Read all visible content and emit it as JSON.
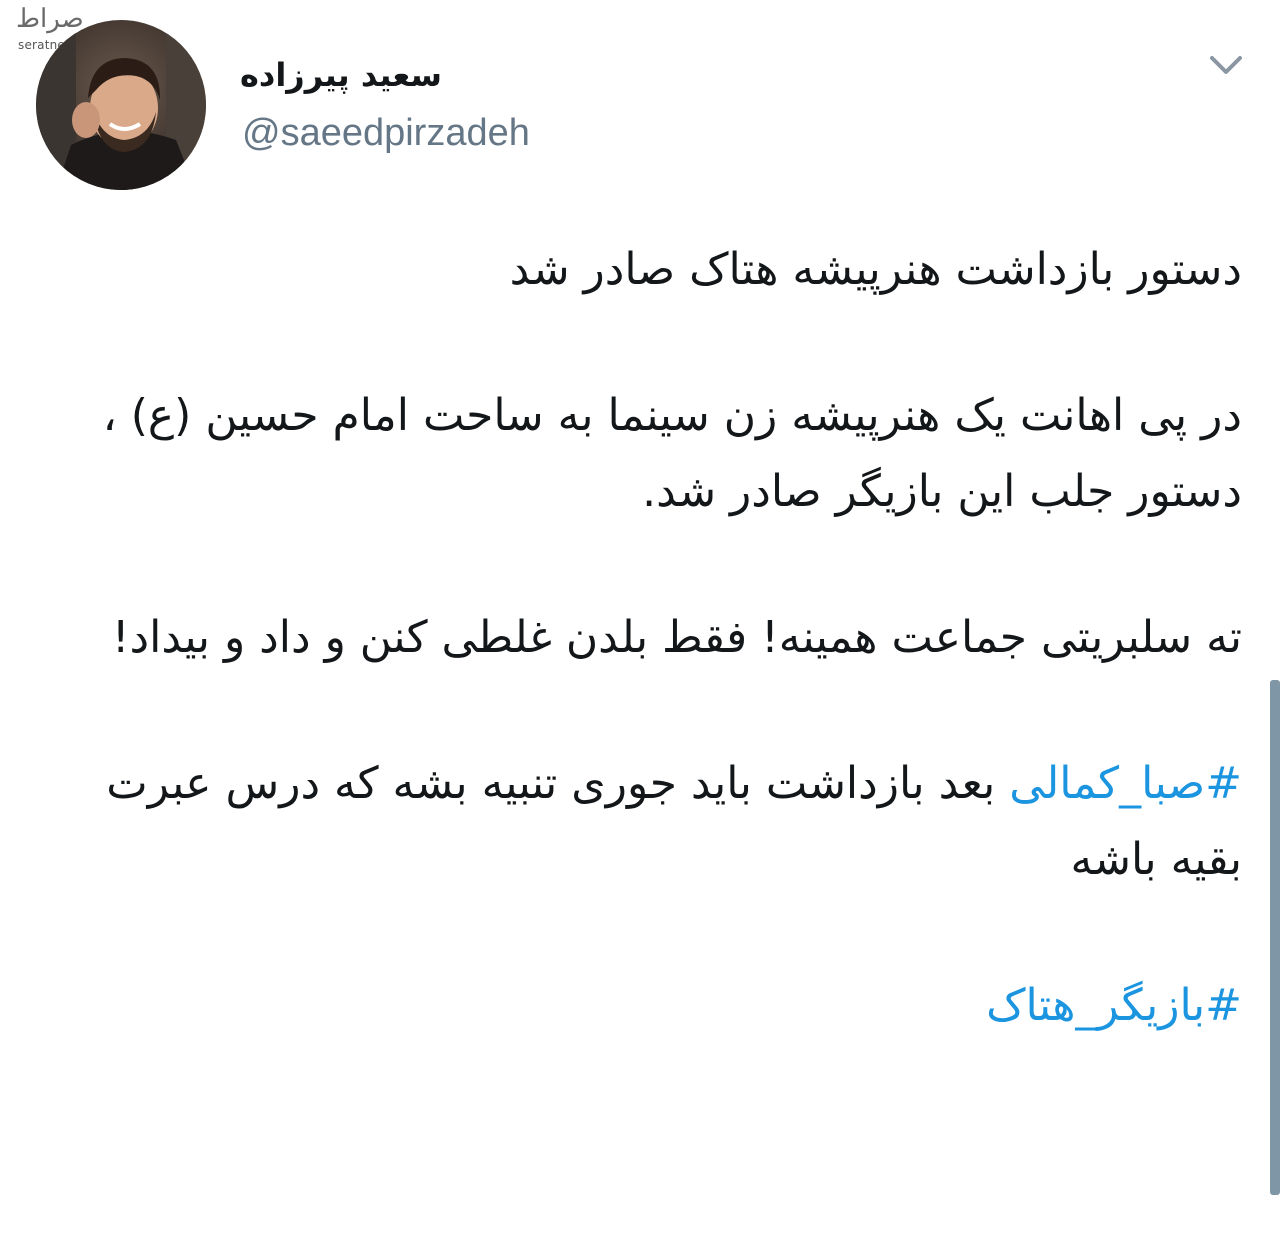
{
  "watermark": {
    "logo_text": "صراط",
    "site": "seratnews.ir"
  },
  "user": {
    "display_name": "سعید پیرزاده",
    "handle": "@saeedpirzadeh"
  },
  "icons": {
    "more_menu": "chevron-down-icon",
    "avatar": "profile-photo"
  },
  "tweet": {
    "line1": "دستور بازداشت هنرپیشه هتاک صادر شد",
    "line2": "در پی اهانت یک هنرپیشه زن سینما به ساحت امام حسین (ع) ، دستور جلب این بازیگر صادر شد.",
    "line3": "ته سلبریتی جماعت همینه! فقط بلدن غلطی کنن و داد و بیداد!",
    "hashtag1": "#صبا_کمالی",
    "line4_rest": " بعد بازداشت باید جوری تنبیه بشه که درس عبرت بقیه باشه",
    "hashtag2": "#بازیگر_هتاک"
  },
  "colors": {
    "hashtag": "#1b95e0",
    "handle": "#657786",
    "text": "#14171a",
    "scrollbar": "#7f96a6"
  }
}
